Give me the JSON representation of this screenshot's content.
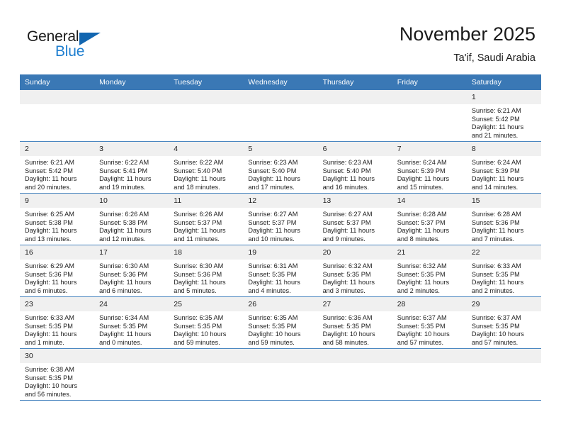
{
  "brand": {
    "name_top": "General",
    "name_bottom": "Blue",
    "accent_color": "#1266b0",
    "text_color": "#1b1b1b"
  },
  "header": {
    "title": "November 2025",
    "subtitle": "Ta'if, Saudi Arabia"
  },
  "calendar": {
    "header_bg": "#3a78b5",
    "daynum_bg": "#f0f0f0",
    "row_border": "#4a86c0",
    "weekdays": [
      "Sunday",
      "Monday",
      "Tuesday",
      "Wednesday",
      "Thursday",
      "Friday",
      "Saturday"
    ],
    "weeks": [
      [
        {
          "day": "",
          "lines": []
        },
        {
          "day": "",
          "lines": []
        },
        {
          "day": "",
          "lines": []
        },
        {
          "day": "",
          "lines": []
        },
        {
          "day": "",
          "lines": []
        },
        {
          "day": "",
          "lines": []
        },
        {
          "day": "1",
          "lines": [
            "Sunrise: 6:21 AM",
            "Sunset: 5:42 PM",
            "Daylight: 11 hours",
            "and 21 minutes."
          ]
        }
      ],
      [
        {
          "day": "2",
          "lines": [
            "Sunrise: 6:21 AM",
            "Sunset: 5:42 PM",
            "Daylight: 11 hours",
            "and 20 minutes."
          ]
        },
        {
          "day": "3",
          "lines": [
            "Sunrise: 6:22 AM",
            "Sunset: 5:41 PM",
            "Daylight: 11 hours",
            "and 19 minutes."
          ]
        },
        {
          "day": "4",
          "lines": [
            "Sunrise: 6:22 AM",
            "Sunset: 5:40 PM",
            "Daylight: 11 hours",
            "and 18 minutes."
          ]
        },
        {
          "day": "5",
          "lines": [
            "Sunrise: 6:23 AM",
            "Sunset: 5:40 PM",
            "Daylight: 11 hours",
            "and 17 minutes."
          ]
        },
        {
          "day": "6",
          "lines": [
            "Sunrise: 6:23 AM",
            "Sunset: 5:40 PM",
            "Daylight: 11 hours",
            "and 16 minutes."
          ]
        },
        {
          "day": "7",
          "lines": [
            "Sunrise: 6:24 AM",
            "Sunset: 5:39 PM",
            "Daylight: 11 hours",
            "and 15 minutes."
          ]
        },
        {
          "day": "8",
          "lines": [
            "Sunrise: 6:24 AM",
            "Sunset: 5:39 PM",
            "Daylight: 11 hours",
            "and 14 minutes."
          ]
        }
      ],
      [
        {
          "day": "9",
          "lines": [
            "Sunrise: 6:25 AM",
            "Sunset: 5:38 PM",
            "Daylight: 11 hours",
            "and 13 minutes."
          ]
        },
        {
          "day": "10",
          "lines": [
            "Sunrise: 6:26 AM",
            "Sunset: 5:38 PM",
            "Daylight: 11 hours",
            "and 12 minutes."
          ]
        },
        {
          "day": "11",
          "lines": [
            "Sunrise: 6:26 AM",
            "Sunset: 5:37 PM",
            "Daylight: 11 hours",
            "and 11 minutes."
          ]
        },
        {
          "day": "12",
          "lines": [
            "Sunrise: 6:27 AM",
            "Sunset: 5:37 PM",
            "Daylight: 11 hours",
            "and 10 minutes."
          ]
        },
        {
          "day": "13",
          "lines": [
            "Sunrise: 6:27 AM",
            "Sunset: 5:37 PM",
            "Daylight: 11 hours",
            "and 9 minutes."
          ]
        },
        {
          "day": "14",
          "lines": [
            "Sunrise: 6:28 AM",
            "Sunset: 5:37 PM",
            "Daylight: 11 hours",
            "and 8 minutes."
          ]
        },
        {
          "day": "15",
          "lines": [
            "Sunrise: 6:28 AM",
            "Sunset: 5:36 PM",
            "Daylight: 11 hours",
            "and 7 minutes."
          ]
        }
      ],
      [
        {
          "day": "16",
          "lines": [
            "Sunrise: 6:29 AM",
            "Sunset: 5:36 PM",
            "Daylight: 11 hours",
            "and 6 minutes."
          ]
        },
        {
          "day": "17",
          "lines": [
            "Sunrise: 6:30 AM",
            "Sunset: 5:36 PM",
            "Daylight: 11 hours",
            "and 6 minutes."
          ]
        },
        {
          "day": "18",
          "lines": [
            "Sunrise: 6:30 AM",
            "Sunset: 5:36 PM",
            "Daylight: 11 hours",
            "and 5 minutes."
          ]
        },
        {
          "day": "19",
          "lines": [
            "Sunrise: 6:31 AM",
            "Sunset: 5:35 PM",
            "Daylight: 11 hours",
            "and 4 minutes."
          ]
        },
        {
          "day": "20",
          "lines": [
            "Sunrise: 6:32 AM",
            "Sunset: 5:35 PM",
            "Daylight: 11 hours",
            "and 3 minutes."
          ]
        },
        {
          "day": "21",
          "lines": [
            "Sunrise: 6:32 AM",
            "Sunset: 5:35 PM",
            "Daylight: 11 hours",
            "and 2 minutes."
          ]
        },
        {
          "day": "22",
          "lines": [
            "Sunrise: 6:33 AM",
            "Sunset: 5:35 PM",
            "Daylight: 11 hours",
            "and 2 minutes."
          ]
        }
      ],
      [
        {
          "day": "23",
          "lines": [
            "Sunrise: 6:33 AM",
            "Sunset: 5:35 PM",
            "Daylight: 11 hours",
            "and 1 minute."
          ]
        },
        {
          "day": "24",
          "lines": [
            "Sunrise: 6:34 AM",
            "Sunset: 5:35 PM",
            "Daylight: 11 hours",
            "and 0 minutes."
          ]
        },
        {
          "day": "25",
          "lines": [
            "Sunrise: 6:35 AM",
            "Sunset: 5:35 PM",
            "Daylight: 10 hours",
            "and 59 minutes."
          ]
        },
        {
          "day": "26",
          "lines": [
            "Sunrise: 6:35 AM",
            "Sunset: 5:35 PM",
            "Daylight: 10 hours",
            "and 59 minutes."
          ]
        },
        {
          "day": "27",
          "lines": [
            "Sunrise: 6:36 AM",
            "Sunset: 5:35 PM",
            "Daylight: 10 hours",
            "and 58 minutes."
          ]
        },
        {
          "day": "28",
          "lines": [
            "Sunrise: 6:37 AM",
            "Sunset: 5:35 PM",
            "Daylight: 10 hours",
            "and 57 minutes."
          ]
        },
        {
          "day": "29",
          "lines": [
            "Sunrise: 6:37 AM",
            "Sunset: 5:35 PM",
            "Daylight: 10 hours",
            "and 57 minutes."
          ]
        }
      ],
      [
        {
          "day": "30",
          "lines": [
            "Sunrise: 6:38 AM",
            "Sunset: 5:35 PM",
            "Daylight: 10 hours",
            "and 56 minutes."
          ]
        },
        {
          "day": "",
          "lines": []
        },
        {
          "day": "",
          "lines": []
        },
        {
          "day": "",
          "lines": []
        },
        {
          "day": "",
          "lines": []
        },
        {
          "day": "",
          "lines": []
        },
        {
          "day": "",
          "lines": []
        }
      ]
    ]
  }
}
